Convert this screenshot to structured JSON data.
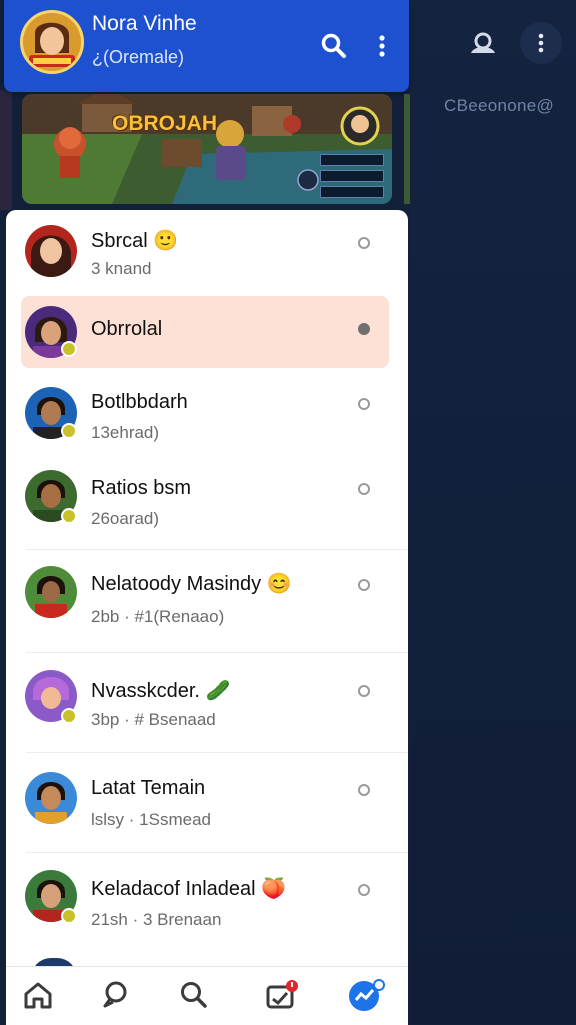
{
  "header": {
    "title": "Nora Vinhe",
    "subtitle": "¿(Oremale)"
  },
  "banner": {
    "title": "OBROJAH"
  },
  "right_panel": {
    "label": "CBeeonone@"
  },
  "chats": [
    {
      "name": "Sbrcal 🙂",
      "sub": "3 knand",
      "selected": false
    },
    {
      "name": "Obrrolal",
      "sub": "",
      "selected": true
    },
    {
      "name": "Botlbbdarh",
      "sub": "13ehrad)",
      "selected": false
    },
    {
      "name": "Ratios bsm",
      "sub": "26oarad)",
      "selected": false
    },
    {
      "name": "Nelatoody Masindy 😊",
      "sub": "2bb · #1(Renaao)",
      "selected": false
    },
    {
      "name": "Nvasskcder. 🥒",
      "sub": "3bp · # Bsenaad",
      "selected": false
    },
    {
      "name": "Latat Temain",
      "sub": "lslsy · 1Ssmead",
      "selected": false
    },
    {
      "name": "Keladacof Inladeal 🍑",
      "sub": "21sh · 3 Brenaan",
      "selected": false
    }
  ],
  "icons": {
    "search": "search-icon",
    "more": "more-vertical-icon",
    "nav": [
      "home-icon",
      "chat-icon",
      "search-icon",
      "inbox-icon",
      "profile-active-icon"
    ]
  },
  "colors": {
    "header": "#1d51cf",
    "highlight": "#fde0d6",
    "accent": "#1d73e8"
  }
}
